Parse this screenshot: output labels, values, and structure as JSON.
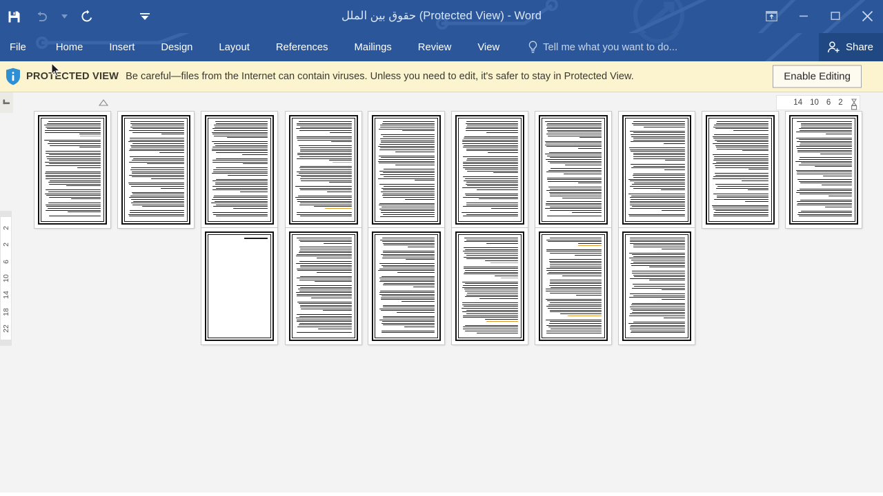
{
  "window": {
    "title": "حقوق بین الملل (Protected View) - Word",
    "accent_color": "#2b579a",
    "quick_access": [
      {
        "name": "save-button",
        "icon": "save-icon",
        "label": "Save"
      },
      {
        "name": "undo-button",
        "icon": "undo-icon",
        "label": "Undo"
      },
      {
        "name": "undo-dropdown",
        "icon": "chevron-down-icon",
        "label": "Undo options"
      },
      {
        "name": "redo-button",
        "icon": "redo-icon",
        "label": "Redo"
      },
      {
        "name": "customize-qat-button",
        "icon": "chevron-down-icon",
        "label": "Customize Quick Access Toolbar"
      }
    ],
    "controls": [
      {
        "name": "ribbon-display-options-button",
        "icon": "ribbon-display-icon",
        "label": "Ribbon Display Options"
      },
      {
        "name": "minimize-button",
        "icon": "minimize-icon",
        "label": "Minimize"
      },
      {
        "name": "maximize-button",
        "icon": "maximize-icon",
        "label": "Restore Down"
      },
      {
        "name": "close-button",
        "icon": "close-icon",
        "label": "Close"
      }
    ]
  },
  "ribbon": {
    "tabs": [
      {
        "label": "File"
      },
      {
        "label": "Home"
      },
      {
        "label": "Insert"
      },
      {
        "label": "Design"
      },
      {
        "label": "Layout"
      },
      {
        "label": "References"
      },
      {
        "label": "Mailings"
      },
      {
        "label": "Review"
      },
      {
        "label": "View"
      }
    ],
    "tell_me": {
      "placeholder": "Tell me what you want to do...",
      "icon": "lightbulb-icon"
    },
    "share": {
      "label": "Share",
      "icon": "person-add-icon"
    }
  },
  "protected_view": {
    "icon": "shield-info-icon",
    "label": "PROTECTED VIEW",
    "message": "Be careful—files from the Internet can contain viruses. Unless you need to edit, it's safer to stay in Protected View.",
    "button_label": "Enable Editing",
    "background_color": "#fcf3cf"
  },
  "rulers": {
    "horizontal_ticks": [
      "14",
      "10",
      "6",
      "2"
    ],
    "vertical_ticks": [
      "2",
      "2",
      "6",
      "10",
      "14",
      "18",
      "22"
    ],
    "tab_selector": "left-tab-stop"
  },
  "document": {
    "zoom_view": "multiple-pages",
    "page_count": 16,
    "heading_color": "#e09a2a",
    "body_text_color": "#1b1b1b",
    "pages": [
      {
        "number": 1,
        "row": 1,
        "col": 1,
        "kind": "text",
        "blank": false,
        "has_highlight": true
      },
      {
        "number": 2,
        "row": 1,
        "col": 2,
        "kind": "text",
        "blank": false,
        "has_highlight": false
      },
      {
        "number": 3,
        "row": 1,
        "col": 3,
        "kind": "text",
        "blank": false,
        "has_highlight": true
      },
      {
        "number": 4,
        "row": 1,
        "col": 4,
        "kind": "text",
        "blank": false,
        "has_highlight": true
      },
      {
        "number": 5,
        "row": 1,
        "col": 5,
        "kind": "text",
        "blank": false,
        "has_highlight": false
      },
      {
        "number": 6,
        "row": 1,
        "col": 6,
        "kind": "text",
        "blank": false,
        "has_highlight": false
      },
      {
        "number": 7,
        "row": 1,
        "col": 7,
        "kind": "text",
        "blank": false,
        "has_highlight": false
      },
      {
        "number": 8,
        "row": 1,
        "col": 8,
        "kind": "text",
        "blank": false,
        "has_highlight": false
      },
      {
        "number": 9,
        "row": 1,
        "col": 9,
        "kind": "text",
        "blank": false,
        "has_highlight": false
      },
      {
        "number": 10,
        "row": 1,
        "col": 10,
        "kind": "text",
        "blank": false,
        "has_highlight": false
      },
      {
        "number": 11,
        "row": 2,
        "col": 1,
        "kind": "text",
        "blank": true,
        "has_highlight": false
      },
      {
        "number": 12,
        "row": 2,
        "col": 2,
        "kind": "text",
        "blank": false,
        "has_highlight": false
      },
      {
        "number": 13,
        "row": 2,
        "col": 3,
        "kind": "text",
        "blank": false,
        "has_highlight": true
      },
      {
        "number": 14,
        "row": 2,
        "col": 4,
        "kind": "text",
        "blank": false,
        "has_highlight": true
      },
      {
        "number": 15,
        "row": 2,
        "col": 5,
        "kind": "text",
        "blank": false,
        "has_highlight": true
      },
      {
        "number": 16,
        "row": 2,
        "col": 6,
        "kind": "text",
        "blank": false,
        "has_highlight": false
      }
    ]
  }
}
